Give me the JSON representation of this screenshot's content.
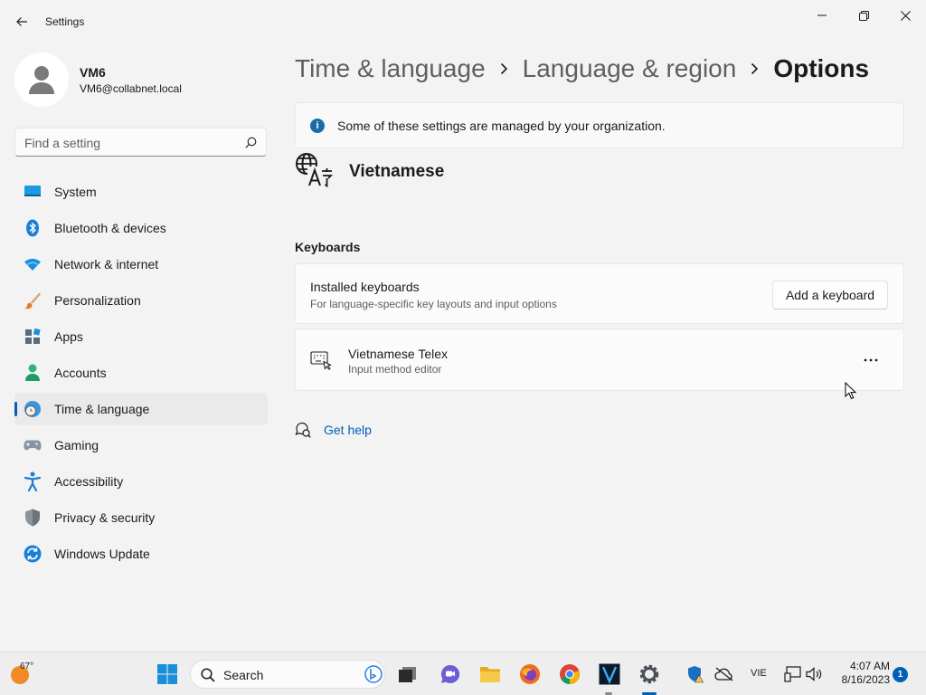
{
  "window": {
    "title": "Settings"
  },
  "profile": {
    "name": "VM6",
    "email": "VM6@collabnet.local"
  },
  "search": {
    "placeholder": "Find a setting"
  },
  "sidebar": {
    "items": [
      {
        "label": "System",
        "icon": "monitor-icon"
      },
      {
        "label": "Bluetooth & devices",
        "icon": "bluetooth-icon"
      },
      {
        "label": "Network & internet",
        "icon": "wifi-icon"
      },
      {
        "label": "Personalization",
        "icon": "paintbrush-icon"
      },
      {
        "label": "Apps",
        "icon": "apps-icon"
      },
      {
        "label": "Accounts",
        "icon": "person-icon"
      },
      {
        "label": "Time & language",
        "icon": "globe-clock-icon",
        "active": true
      },
      {
        "label": "Gaming",
        "icon": "gamepad-icon"
      },
      {
        "label": "Accessibility",
        "icon": "accessibility-icon"
      },
      {
        "label": "Privacy & security",
        "icon": "shield-icon"
      },
      {
        "label": "Windows Update",
        "icon": "update-icon"
      }
    ]
  },
  "breadcrumb": {
    "items": [
      "Time & language",
      "Language & region"
    ],
    "current": "Options"
  },
  "info_bar": {
    "message": "Some of these settings are managed by your organization."
  },
  "language": {
    "name": "Vietnamese"
  },
  "keyboards": {
    "section_title": "Keyboards",
    "installed": {
      "title": "Installed keyboards",
      "subtitle": "For language-specific key layouts and input options",
      "button_label": "Add a keyboard"
    },
    "items": [
      {
        "title": "Vietnamese Telex",
        "subtitle": "Input method editor"
      }
    ]
  },
  "help": {
    "label": "Get help"
  },
  "taskbar": {
    "weather_temp": "67°",
    "search_label": "Search",
    "language_indicator": "VIE",
    "time": "4:07 AM",
    "date": "8/16/2023",
    "notification_count": "1"
  },
  "colors": {
    "accent": "#005fb8",
    "background": "#f3f3f3",
    "card": "#fbfbfb"
  }
}
